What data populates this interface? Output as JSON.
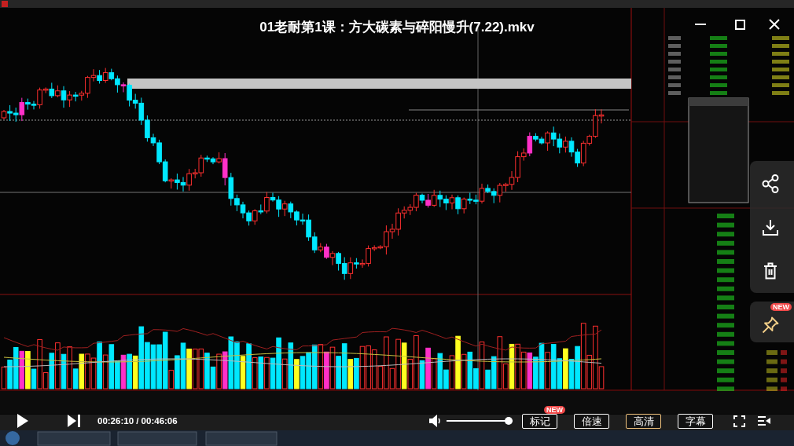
{
  "window": {
    "title": "01老耐第1课：方大碳素与碎阳慢升(7.22).mkv"
  },
  "side_panel": {
    "actions": [
      {
        "kind": "share"
      },
      {
        "kind": "download"
      },
      {
        "kind": "delete"
      }
    ]
  },
  "pin_panel": {
    "badge": "NEW"
  },
  "controls": {
    "time": "00:26:10 / 00:46:06",
    "volume": {
      "level": 1.0
    },
    "buttons": [
      {
        "label": "标记",
        "badge": "NEW",
        "selected": false
      },
      {
        "label": "倍速",
        "selected": false
      },
      {
        "label": "高清",
        "selected": true
      },
      {
        "label": "字幕",
        "selected": false
      }
    ]
  }
}
